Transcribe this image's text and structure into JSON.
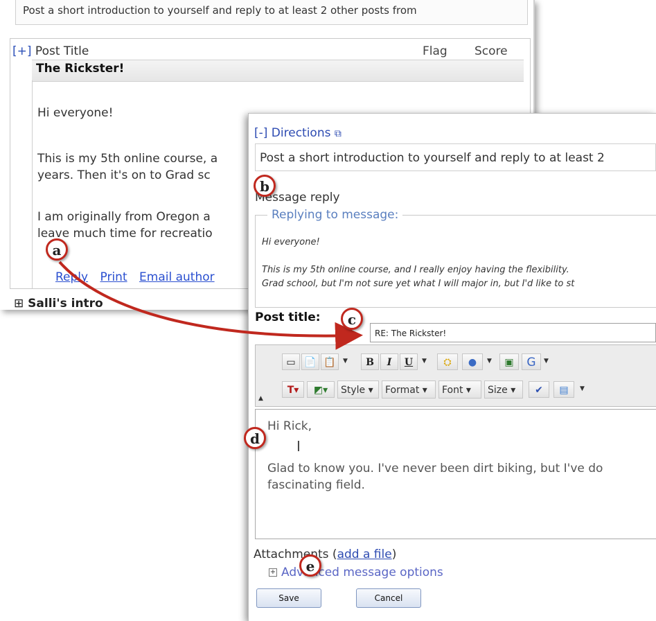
{
  "back": {
    "intro": "Post a short introduction to yourself and reply to at least 2 other posts from",
    "header": {
      "expand": "[+]",
      "title": "Post Title",
      "flag": "Flag",
      "score": "Score"
    },
    "post_title": "The Rickster!",
    "greeting": "Hi everyone!",
    "para1_line1": "This is my 5th online course, a",
    "para1_line2": "years.  Then it's on to Grad sc",
    "para2_line1": "I am originally from Oregon a",
    "para2_line2": "leave much time for recreatio",
    "links": [
      "Reply",
      "Print",
      "Email author"
    ],
    "next_item": "Salli's intro"
  },
  "front": {
    "directions_label": "[-] Directions",
    "directions_text": "Post a short introduction to yourself and reply to at least 2",
    "message_reply_label": "Message reply",
    "replying_legend": "Replying to message:",
    "quote_line1": "Hi everyone!",
    "quote_line2": "This is my 5th online course, and I really enjoy having the flexibility.",
    "quote_line3": "Grad school, but I'm not sure yet what I will major in, but I'd like to st",
    "post_title_label": "Post title:",
    "post_title_value": "RE: The Rickster!",
    "toolbar": {
      "bold": "B",
      "italic": "I",
      "underline": "U",
      "style": "Style",
      "format": "Format",
      "font": "Font",
      "size": "Size"
    },
    "editor_line1": "Hi Rick,",
    "editor_line2": "Glad to know you.  I've never been dirt biking, but I've do",
    "editor_line3": "fascinating field.",
    "attachments_label": "Attachments (",
    "add_file": "add a file",
    "attachments_close": ")",
    "advanced_options": "Advanced message options",
    "save": "Save",
    "cancel": "Cancel"
  },
  "markers": [
    "a",
    "b",
    "c",
    "d",
    "e"
  ],
  "colors": {
    "marker_border": "#c0281e",
    "arrow": "#c0281e",
    "link": "#2a4fd0"
  }
}
